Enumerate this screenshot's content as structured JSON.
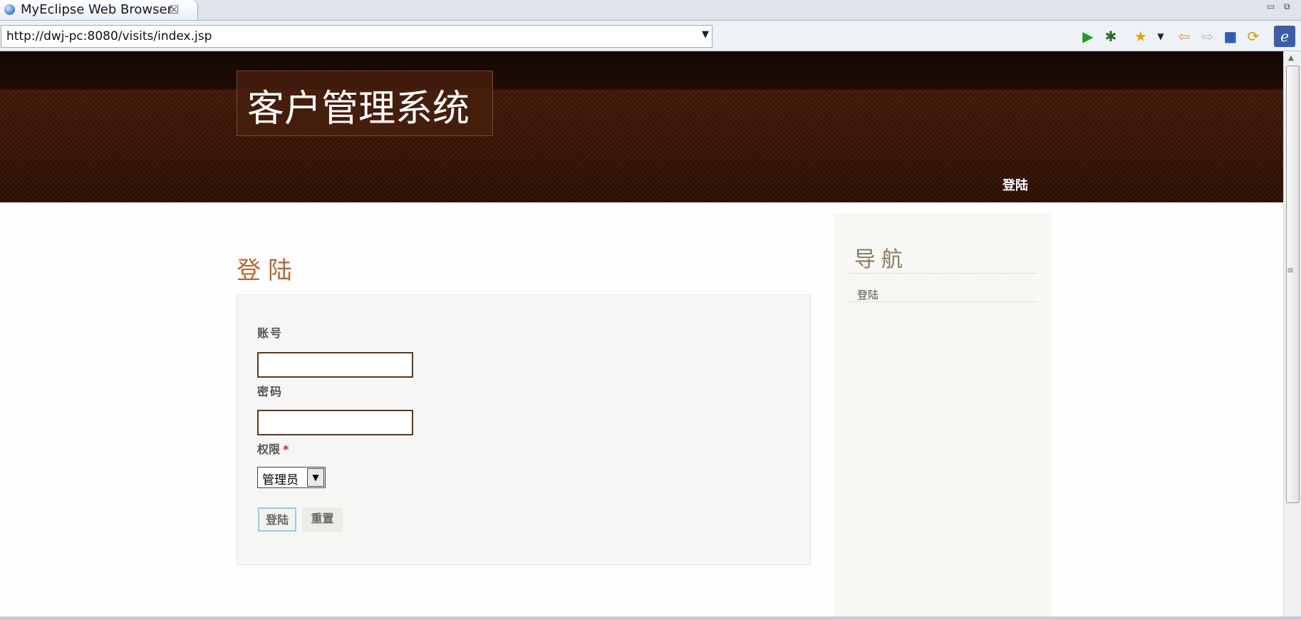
{
  "ide": {
    "tab_title": "MyEclipse Web Browser",
    "tab_close": "☒",
    "minimize": "▭",
    "restore": "⧉"
  },
  "browser": {
    "url": "http://dwj-pc:8080/visits/index.jsp",
    "dropdown_arrow": "▼",
    "toolbar_icons": [
      "run-icon",
      "debug-icon",
      "favorites-icon",
      "favorites-menu-icon",
      "back-icon",
      "forward-icon",
      "stop-icon",
      "refresh-icon",
      "eclipse-logo-icon"
    ]
  },
  "site": {
    "title": "客户管理系统",
    "topnav": {
      "login": "登陆"
    },
    "main": {
      "heading": "登陆",
      "form": {
        "account_label": "账号",
        "account_value": "",
        "password_label": "密码",
        "password_value": "",
        "role_label": "权限",
        "role_required": "*",
        "role_selected": "管理员",
        "login_button": "登陆",
        "reset_button": "重置"
      }
    },
    "sidebar": {
      "heading": "导航",
      "items": [
        {
          "label": "登陆"
        }
      ]
    }
  },
  "colors": {
    "header_bg": "#3a1406",
    "heading_orange": "#b8663a",
    "required_red": "#c0282b",
    "input_border": "#5b3a1c"
  }
}
